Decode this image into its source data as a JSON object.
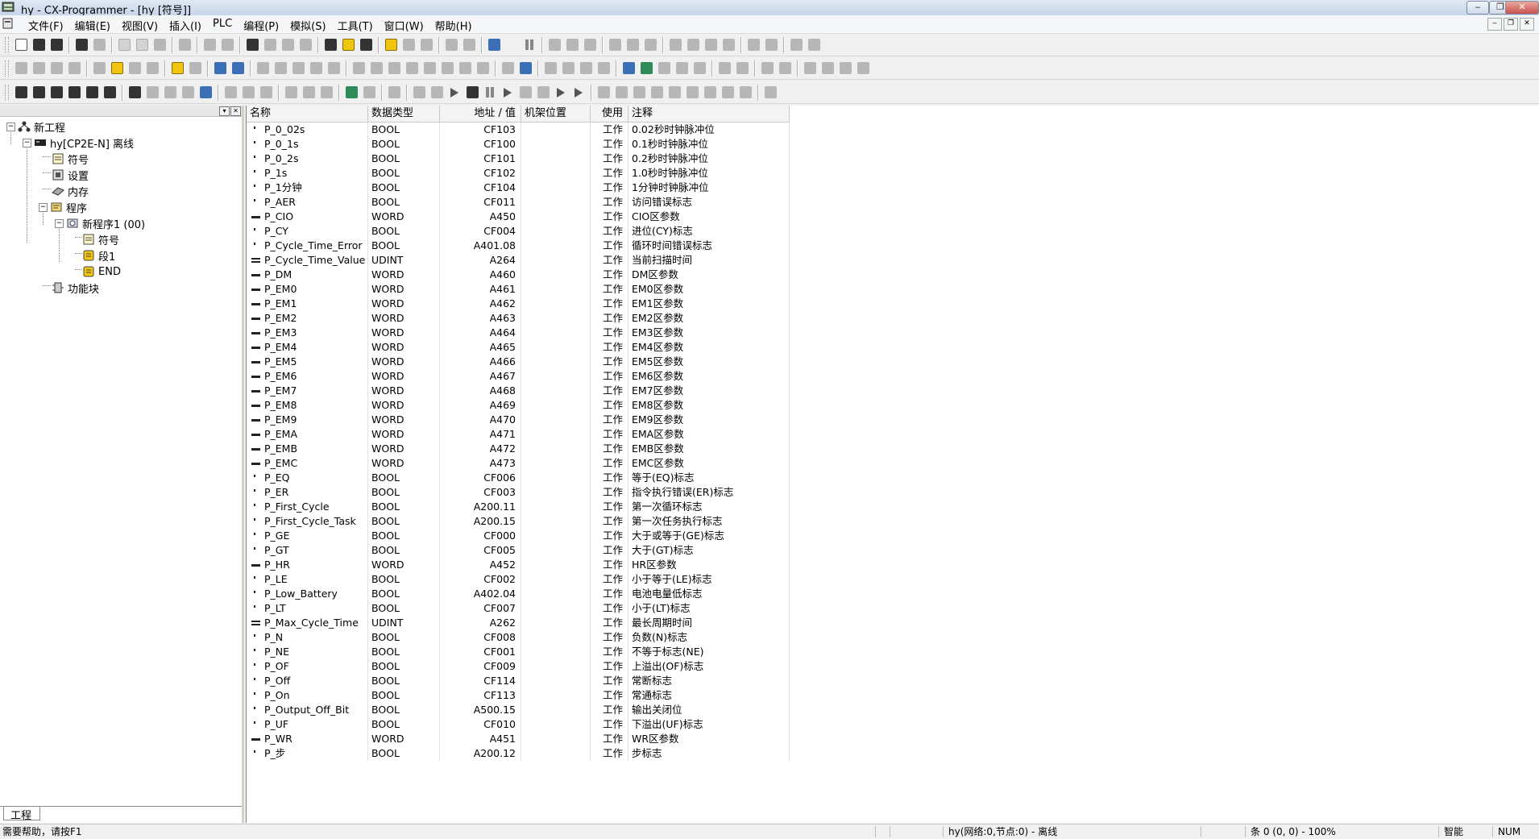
{
  "window": {
    "title": "hy - CX-Programmer - [hy [符号]]",
    "minimize_glyph": "‒",
    "restore_glyph": "❐",
    "close_glyph": "✕"
  },
  "menu": {
    "items": [
      "文件(F)",
      "编辑(E)",
      "视图(V)",
      "插入(I)",
      "PLC",
      "编程(P)",
      "模拟(S)",
      "工具(T)",
      "窗口(W)",
      "帮助(H)"
    ],
    "mdi_min": "‒",
    "mdi_restore": "❐",
    "mdi_close": "✕"
  },
  "project_panel": {
    "tab_label": "工程",
    "tree": {
      "root": "新工程",
      "plc": "hy[CP2E-N] 离线",
      "symbols": "符号",
      "settings": "设置",
      "memory": "内存",
      "programs": "程序",
      "program1": "新程序1 (00)",
      "program1_symbols": "符号",
      "section1": "段1",
      "end": "END",
      "function_blocks": "功能块"
    }
  },
  "table": {
    "headers": [
      "名称",
      "数据类型",
      "地址 / 值",
      "机架位置",
      "使用",
      "注释"
    ],
    "rows": [
      {
        "name": "P_0_02s",
        "type": "BOOL",
        "address": "CF103",
        "rack": "",
        "usage": "工作",
        "comment": "0.02秒时钟脉冲位"
      },
      {
        "name": "P_0_1s",
        "type": "BOOL",
        "address": "CF100",
        "rack": "",
        "usage": "工作",
        "comment": "0.1秒时钟脉冲位"
      },
      {
        "name": "P_0_2s",
        "type": "BOOL",
        "address": "CF101",
        "rack": "",
        "usage": "工作",
        "comment": "0.2秒时钟脉冲位"
      },
      {
        "name": "P_1s",
        "type": "BOOL",
        "address": "CF102",
        "rack": "",
        "usage": "工作",
        "comment": "1.0秒时钟脉冲位"
      },
      {
        "name": "P_1分钟",
        "type": "BOOL",
        "address": "CF104",
        "rack": "",
        "usage": "工作",
        "comment": "1分钟时钟脉冲位"
      },
      {
        "name": "P_AER",
        "type": "BOOL",
        "address": "CF011",
        "rack": "",
        "usage": "工作",
        "comment": "访问错误标志"
      },
      {
        "name": "P_CIO",
        "type": "WORD",
        "address": "A450",
        "rack": "",
        "usage": "工作",
        "comment": "CIO区参数"
      },
      {
        "name": "P_CY",
        "type": "BOOL",
        "address": "CF004",
        "rack": "",
        "usage": "工作",
        "comment": "进位(CY)标志"
      },
      {
        "name": "P_Cycle_Time_Error",
        "type": "BOOL",
        "address": "A401.08",
        "rack": "",
        "usage": "工作",
        "comment": "循环时间错误标志"
      },
      {
        "name": "P_Cycle_Time_Value",
        "type": "UDINT",
        "address": "A264",
        "rack": "",
        "usage": "工作",
        "comment": "当前扫描时间"
      },
      {
        "name": "P_DM",
        "type": "WORD",
        "address": "A460",
        "rack": "",
        "usage": "工作",
        "comment": "DM区参数"
      },
      {
        "name": "P_EM0",
        "type": "WORD",
        "address": "A461",
        "rack": "",
        "usage": "工作",
        "comment": "EM0区参数"
      },
      {
        "name": "P_EM1",
        "type": "WORD",
        "address": "A462",
        "rack": "",
        "usage": "工作",
        "comment": "EM1区参数"
      },
      {
        "name": "P_EM2",
        "type": "WORD",
        "address": "A463",
        "rack": "",
        "usage": "工作",
        "comment": "EM2区参数"
      },
      {
        "name": "P_EM3",
        "type": "WORD",
        "address": "A464",
        "rack": "",
        "usage": "工作",
        "comment": "EM3区参数"
      },
      {
        "name": "P_EM4",
        "type": "WORD",
        "address": "A465",
        "rack": "",
        "usage": "工作",
        "comment": "EM4区参数"
      },
      {
        "name": "P_EM5",
        "type": "WORD",
        "address": "A466",
        "rack": "",
        "usage": "工作",
        "comment": "EM5区参数"
      },
      {
        "name": "P_EM6",
        "type": "WORD",
        "address": "A467",
        "rack": "",
        "usage": "工作",
        "comment": "EM6区参数"
      },
      {
        "name": "P_EM7",
        "type": "WORD",
        "address": "A468",
        "rack": "",
        "usage": "工作",
        "comment": "EM7区参数"
      },
      {
        "name": "P_EM8",
        "type": "WORD",
        "address": "A469",
        "rack": "",
        "usage": "工作",
        "comment": "EM8区参数"
      },
      {
        "name": "P_EM9",
        "type": "WORD",
        "address": "A470",
        "rack": "",
        "usage": "工作",
        "comment": "EM9区参数"
      },
      {
        "name": "P_EMA",
        "type": "WORD",
        "address": "A471",
        "rack": "",
        "usage": "工作",
        "comment": "EMA区参数"
      },
      {
        "name": "P_EMB",
        "type": "WORD",
        "address": "A472",
        "rack": "",
        "usage": "工作",
        "comment": "EMB区参数"
      },
      {
        "name": "P_EMC",
        "type": "WORD",
        "address": "A473",
        "rack": "",
        "usage": "工作",
        "comment": "EMC区参数"
      },
      {
        "name": "P_EQ",
        "type": "BOOL",
        "address": "CF006",
        "rack": "",
        "usage": "工作",
        "comment": "等于(EQ)标志"
      },
      {
        "name": "P_ER",
        "type": "BOOL",
        "address": "CF003",
        "rack": "",
        "usage": "工作",
        "comment": "指令执行错误(ER)标志"
      },
      {
        "name": "P_First_Cycle",
        "type": "BOOL",
        "address": "A200.11",
        "rack": "",
        "usage": "工作",
        "comment": "第一次循环标志"
      },
      {
        "name": "P_First_Cycle_Task",
        "type": "BOOL",
        "address": "A200.15",
        "rack": "",
        "usage": "工作",
        "comment": "第一次任务执行标志"
      },
      {
        "name": "P_GE",
        "type": "BOOL",
        "address": "CF000",
        "rack": "",
        "usage": "工作",
        "comment": "大于或等于(GE)标志"
      },
      {
        "name": "P_GT",
        "type": "BOOL",
        "address": "CF005",
        "rack": "",
        "usage": "工作",
        "comment": "大于(GT)标志"
      },
      {
        "name": "P_HR",
        "type": "WORD",
        "address": "A452",
        "rack": "",
        "usage": "工作",
        "comment": "HR区参数"
      },
      {
        "name": "P_LE",
        "type": "BOOL",
        "address": "CF002",
        "rack": "",
        "usage": "工作",
        "comment": "小于等于(LE)标志"
      },
      {
        "name": "P_Low_Battery",
        "type": "BOOL",
        "address": "A402.04",
        "rack": "",
        "usage": "工作",
        "comment": "电池电量低标志"
      },
      {
        "name": "P_LT",
        "type": "BOOL",
        "address": "CF007",
        "rack": "",
        "usage": "工作",
        "comment": "小于(LT)标志"
      },
      {
        "name": "P_Max_Cycle_Time",
        "type": "UDINT",
        "address": "A262",
        "rack": "",
        "usage": "工作",
        "comment": "最长周期时间"
      },
      {
        "name": "P_N",
        "type": "BOOL",
        "address": "CF008",
        "rack": "",
        "usage": "工作",
        "comment": "负数(N)标志"
      },
      {
        "name": "P_NE",
        "type": "BOOL",
        "address": "CF001",
        "rack": "",
        "usage": "工作",
        "comment": "不等于标志(NE)"
      },
      {
        "name": "P_OF",
        "type": "BOOL",
        "address": "CF009",
        "rack": "",
        "usage": "工作",
        "comment": "上溢出(OF)标志"
      },
      {
        "name": "P_Off",
        "type": "BOOL",
        "address": "CF114",
        "rack": "",
        "usage": "工作",
        "comment": "常断标志"
      },
      {
        "name": "P_On",
        "type": "BOOL",
        "address": "CF113",
        "rack": "",
        "usage": "工作",
        "comment": "常通标志"
      },
      {
        "name": "P_Output_Off_Bit",
        "type": "BOOL",
        "address": "A500.15",
        "rack": "",
        "usage": "工作",
        "comment": "输出关闭位"
      },
      {
        "name": "P_UF",
        "type": "BOOL",
        "address": "CF010",
        "rack": "",
        "usage": "工作",
        "comment": "下溢出(UF)标志"
      },
      {
        "name": "P_WR",
        "type": "WORD",
        "address": "A451",
        "rack": "",
        "usage": "工作",
        "comment": "WR区参数"
      },
      {
        "name": "P_步",
        "type": "BOOL",
        "address": "A200.12",
        "rack": "",
        "usage": "工作",
        "comment": "步标志"
      }
    ]
  },
  "status_bar": {
    "help": "需要帮助，请按F1",
    "connection": "hy(网络:0,节点:0) - 离线",
    "position": "条 0 (0, 0) - 100%",
    "mode": "智能",
    "numlock": "NUM"
  }
}
